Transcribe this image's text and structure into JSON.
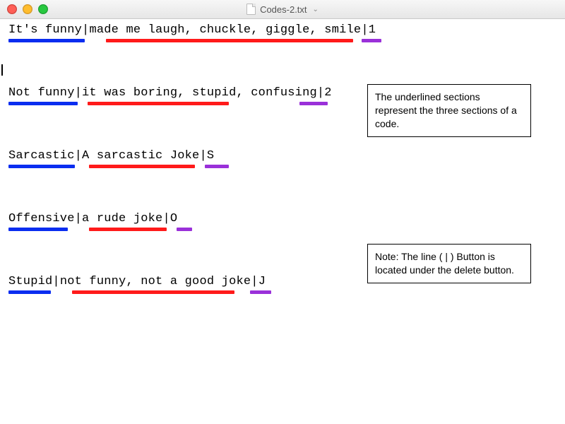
{
  "window": {
    "filename": "Codes-2.txt",
    "dropdown_glyph": "⌄"
  },
  "entries": [
    {
      "part1": "It's funny",
      "part2": "made me laugh, chuckle, giggle, smile",
      "part3": "1",
      "ul": {
        "blue_w": 108,
        "gap1": 30,
        "red_w": 350,
        "gap2": 12,
        "purple_w": 28
      }
    },
    {
      "part1": "Not funny",
      "part2": "it was boring, stupid, confusing",
      "part3": "2",
      "ul": {
        "blue_w": 98,
        "gap1": 14,
        "red_w": 200,
        "gap2": 100,
        "purple_w": 40
      }
    },
    {
      "part1": "Sarcastic",
      "part2": "A sarcastic Joke",
      "part3": "S",
      "ul": {
        "blue_w": 94,
        "gap1": 20,
        "red_w": 150,
        "gap2": 14,
        "purple_w": 34
      }
    },
    {
      "part1": "Offensive",
      "part2": "a rude joke",
      "part3": "O",
      "ul": {
        "blue_w": 84,
        "gap1": 30,
        "red_w": 110,
        "gap2": 14,
        "purple_w": 22
      }
    },
    {
      "part1": "Stupid",
      "part2": "not funny, not a good joke",
      "part3": "J",
      "ul": {
        "blue_w": 60,
        "gap1": 30,
        "red_w": 230,
        "gap2": 22,
        "purple_w": 30
      }
    }
  ],
  "notes": {
    "n1": "The underlined sections represent the three sections of a code.",
    "n2": "Note: The line ( | ) Button is located under the delete button."
  },
  "sep": "|"
}
